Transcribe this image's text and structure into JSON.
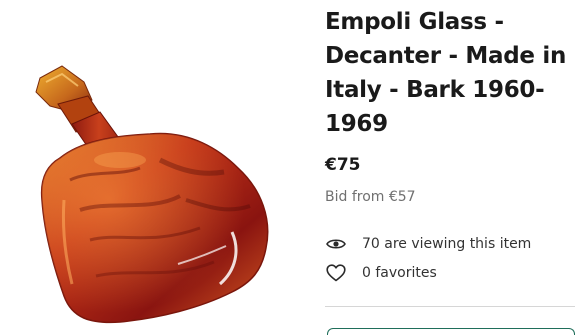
{
  "product": {
    "image_alt": "Amber glass decanter with stopper",
    "title": "Empoli Glass - Decanter - Made in Italy - Bark 1960-1969",
    "price": "€75",
    "bid_from": "Bid from €57"
  },
  "stats": {
    "viewing_text": "70 are viewing this item",
    "favorites_text": "0 favorites"
  },
  "icons": {
    "viewing": "eye-icon",
    "favorites": "heart-icon"
  },
  "colors": {
    "text_dark": "#1a1a1a",
    "text_muted": "#707070",
    "accent": "#1f6e5a",
    "glass_amber": "#c0311a"
  }
}
